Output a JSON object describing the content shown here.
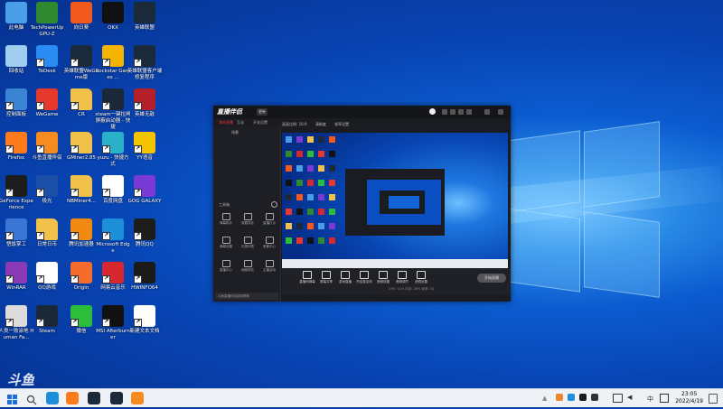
{
  "desktop": {
    "icons": [
      {
        "label": "此电脑",
        "icon": "computer-icon",
        "color": "#4a9ee8"
      },
      {
        "label": "TechPowerUp GPU-Z",
        "icon": "gpuz-icon",
        "color": "#2f8a2f"
      },
      {
        "label": "向日葵",
        "icon": "sunlogin-icon",
        "color": "#f25a1d"
      },
      {
        "label": "OKX",
        "icon": "okx-icon",
        "color": "#111111"
      },
      {
        "label": "英雄联盟",
        "icon": "lol-icon",
        "color": "#1b2a3a"
      },
      {
        "label": "回收站",
        "icon": "recycle-bin-icon",
        "color": "#9fcdf0"
      },
      {
        "label": "ToDesk",
        "icon": "todesk-icon",
        "color": "#2a8cf2"
      },
      {
        "label": "英雄联盟WeGame版",
        "icon": "lol-wegame-icon",
        "color": "#1b2a3a"
      },
      {
        "label": "Rockstar Games ...",
        "icon": "rockstar-icon",
        "color": "#f5b400"
      },
      {
        "label": "英雄联盟客户端修复程序",
        "icon": "lol-repair-icon",
        "color": "#1b2a3a"
      },
      {
        "label": "控制面板",
        "icon": "control-panel-icon",
        "color": "#3a84d4"
      },
      {
        "label": "WeGame",
        "icon": "wegame-icon",
        "color": "#e6382d"
      },
      {
        "label": "CR",
        "icon": "folder-icon",
        "color": "#f2c14a"
      },
      {
        "label": "steam一键拉闸屏蔽启动器 - 快捷",
        "icon": "steam-icon",
        "color": "#1b2838"
      },
      {
        "label": "英雄无敌",
        "icon": "hero-icon",
        "color": "#b4202a"
      },
      {
        "label": "Firefox",
        "icon": "firefox-icon",
        "color": "#ff7a1a"
      },
      {
        "label": "斗鱼直播伴侣",
        "icon": "douyu-icon",
        "color": "#f68b1f"
      },
      {
        "label": "GMiner2.85",
        "icon": "folder-icon",
        "color": "#f2c14a"
      },
      {
        "label": "yuzu - 快捷方式",
        "icon": "yuzu-icon",
        "color": "#2ab3c8"
      },
      {
        "label": "YY语音",
        "icon": "yy-icon",
        "color": "#f5c400"
      },
      {
        "label": "GeForce Experience",
        "icon": "geforce-icon",
        "color": "#1d1d1d"
      },
      {
        "label": "极光",
        "icon": "jiguang-icon",
        "color": "#1c4fa8"
      },
      {
        "label": "NBMiner4...",
        "icon": "folder-icon",
        "color": "#f2c14a"
      },
      {
        "label": "百度网盘",
        "icon": "baidu-pan-icon",
        "color": "#ffffff"
      },
      {
        "label": "GOG GALAXY",
        "icon": "gog-icon",
        "color": "#7b3ad6"
      },
      {
        "label": "悟饭掌工",
        "icon": "wufan-icon",
        "color": "#3a76d4"
      },
      {
        "label": "日常日币",
        "icon": "folder-icon",
        "color": "#f2c14a"
      },
      {
        "label": "腾讯加速器",
        "icon": "tencent-booster-icon",
        "color": "#f08a12"
      },
      {
        "label": "Microsoft Edge",
        "icon": "edge-icon",
        "color": "#1d8fd8"
      },
      {
        "label": "腾讯QQ",
        "icon": "qq-icon",
        "color": "#1d1d1d"
      },
      {
        "label": "WinRAR",
        "icon": "winrar-icon",
        "color": "#8a3ab4"
      },
      {
        "label": "QQ游戏",
        "icon": "qq-game-icon",
        "color": "#ffffff"
      },
      {
        "label": "Origin",
        "icon": "origin-icon",
        "color": "#f56c2d"
      },
      {
        "label": "网易云音乐",
        "icon": "netease-music-icon",
        "color": "#d7282f"
      },
      {
        "label": "HWINFO64",
        "icon": "hwinfo-icon",
        "color": "#1a1a1a"
      },
      {
        "label": "人类一败涂地 Human Fa...",
        "icon": "human-fall-flat-icon",
        "color": "#dcdcdc"
      },
      {
        "label": "Steam",
        "icon": "steam-icon",
        "color": "#1b2838"
      },
      {
        "label": "微信",
        "icon": "wechat-icon",
        "color": "#2cbd3a"
      },
      {
        "label": "MSI Afterburner",
        "icon": "afterburner-icon",
        "color": "#111111"
      },
      {
        "label": "新建文本文档",
        "icon": "text-document-icon",
        "color": "#ffffff"
      }
    ],
    "watermark": "斗鱼"
  },
  "app_window": {
    "brand": "直播伴侣",
    "version_badge": "更新",
    "tabs": [
      {
        "label": "我的直播",
        "active": true
      },
      {
        "label": "互动"
      },
      {
        "label": "开关设置"
      }
    ],
    "scene_label": "场景",
    "toolbox_label": "工具箱",
    "tools": [
      {
        "label": "弹幕助手"
      },
      {
        "label": "观看排名"
      },
      {
        "label": "直播打点"
      },
      {
        "label": "弹幕设置"
      },
      {
        "label": "礼物列表"
      },
      {
        "label": "房管中心"
      },
      {
        "label": "直播中心"
      },
      {
        "label": "贡献排名"
      },
      {
        "label": "主播活动"
      }
    ],
    "preview_header": [
      {
        "label": "画面比例: 16:9"
      },
      {
        "label": "清晰度"
      },
      {
        "label": "帧率设置"
      }
    ],
    "bottom_actions": [
      {
        "label": "直播间弹幕"
      },
      {
        "label": "屏幕共享"
      },
      {
        "label": "游戏直播"
      },
      {
        "label": "开启麦克风"
      },
      {
        "label": "音频设置"
      },
      {
        "label": "音频调节"
      },
      {
        "label": "滤镜设置"
      }
    ],
    "start_button": "开始直播",
    "notice": "斗鱼直播伴侣使用帮助",
    "status_text": "CPU: 11%  内存: 28%  帧率: 30",
    "accent": "#ff3a30"
  },
  "taskbar": {
    "time": "23:05",
    "date": "2022/4/19",
    "tray_lang": "中",
    "pinned": [
      {
        "icon": "windows-start-icon"
      },
      {
        "icon": "search-icon"
      },
      {
        "icon": "edge-taskbar-icon"
      },
      {
        "icon": "firefox-taskbar-icon"
      },
      {
        "icon": "lol-taskbar-icon"
      },
      {
        "icon": "lol-wegame-taskbar-icon"
      },
      {
        "icon": "douyu-taskbar-icon"
      }
    ]
  }
}
